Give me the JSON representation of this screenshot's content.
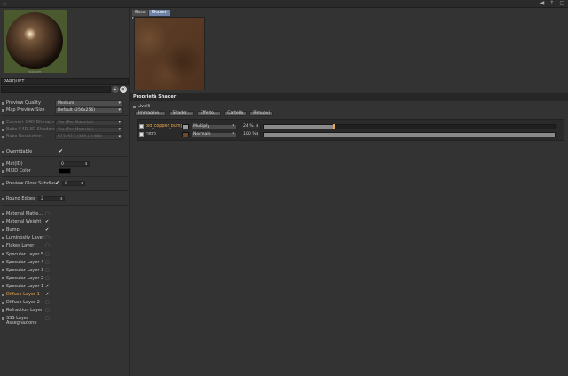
{
  "topbar": {
    "grip": "::",
    "icons": [
      "◀",
      "↑",
      "▢"
    ]
  },
  "material": {
    "name": "PARQUET",
    "preview_caption": "PARQUET"
  },
  "search": {
    "placeholder": ""
  },
  "settings": [
    {
      "key": "preview-quality",
      "label": "Preview Quality",
      "type": "dropdown",
      "value": "Medium",
      "dim": false
    },
    {
      "key": "map-preview-size",
      "label": "Map Preview Size",
      "type": "dropdown",
      "value": "Default (256x256)",
      "dim": false
    },
    {
      "key": "convert-c4d-bitmaps",
      "label": "Convert C4D Bitmaps",
      "type": "dropdown",
      "value": "Yes (Per Material)",
      "dim": true
    },
    {
      "key": "bake-c4d-3d-shaders",
      "label": "Bake C4D 3D Shaders",
      "type": "dropdown",
      "value": "Yes (Per Material)",
      "dim": true
    },
    {
      "key": "bake-resolution",
      "label": "Bake Resolution",
      "type": "dropdown",
      "value": "512x512 (260 / 2 MB)",
      "dim": true
    }
  ],
  "overridable": {
    "label": "Overridable",
    "checked": true
  },
  "id_settings": [
    {
      "key": "mat-id",
      "label": "Mat(ID)",
      "type": "number",
      "value": "0"
    },
    {
      "key": "mxid-color",
      "label": "MXID Color",
      "type": "color",
      "color": "#000000"
    }
  ],
  "gloss": {
    "label": "Preview Gloss Subdivs",
    "checked": true,
    "value": "9"
  },
  "round_edges": {
    "label": "Round Edges",
    "value": "2"
  },
  "layers_panel": {
    "items": [
      {
        "label": "Material Matte...",
        "checked": false
      },
      {
        "label": "Material Weight",
        "checked": true
      },
      {
        "label": "Bump",
        "checked": true
      },
      {
        "label": "Luminosity Layer",
        "checked": false
      },
      {
        "label": "Flakes Layer",
        "checked": false
      },
      {
        "label": "Specular Layer 5",
        "checked": false
      },
      {
        "label": "Specular Layer 4",
        "checked": false
      },
      {
        "label": "Specular Layer 3",
        "checked": false
      },
      {
        "label": "Specular Layer 2",
        "checked": false
      },
      {
        "label": "Specular Layer 1",
        "checked": true
      },
      {
        "label": "Diffuse Layer 1",
        "checked": true,
        "active": true
      },
      {
        "label": "Diffuse Layer 2",
        "checked": false
      },
      {
        "label": "Refraction Layer",
        "checked": false
      },
      {
        "label": "SSS Layer",
        "checked": false
      }
    ],
    "assign_label": "Assegnazione"
  },
  "tabs": [
    {
      "label": "Base",
      "selected": false
    },
    {
      "label": "Shader",
      "selected": true
    }
  ],
  "shader_props": {
    "header": "Proprietà Shader",
    "livelli_label": "Livelli",
    "buttons": [
      "Immagine...",
      "Shader...",
      "Effetto...",
      "Cartella",
      "Rimuovi"
    ],
    "layers": [
      {
        "name": "old_copper_bump",
        "thumb_color": "#9a9a9a",
        "blend": "Multiply",
        "percent": "24 %",
        "value": 0.24
      },
      {
        "name": "Filtro",
        "thumb_color": "#6b4a2e",
        "blend": "Normale",
        "percent": "100 %",
        "value": 1.0
      }
    ]
  }
}
